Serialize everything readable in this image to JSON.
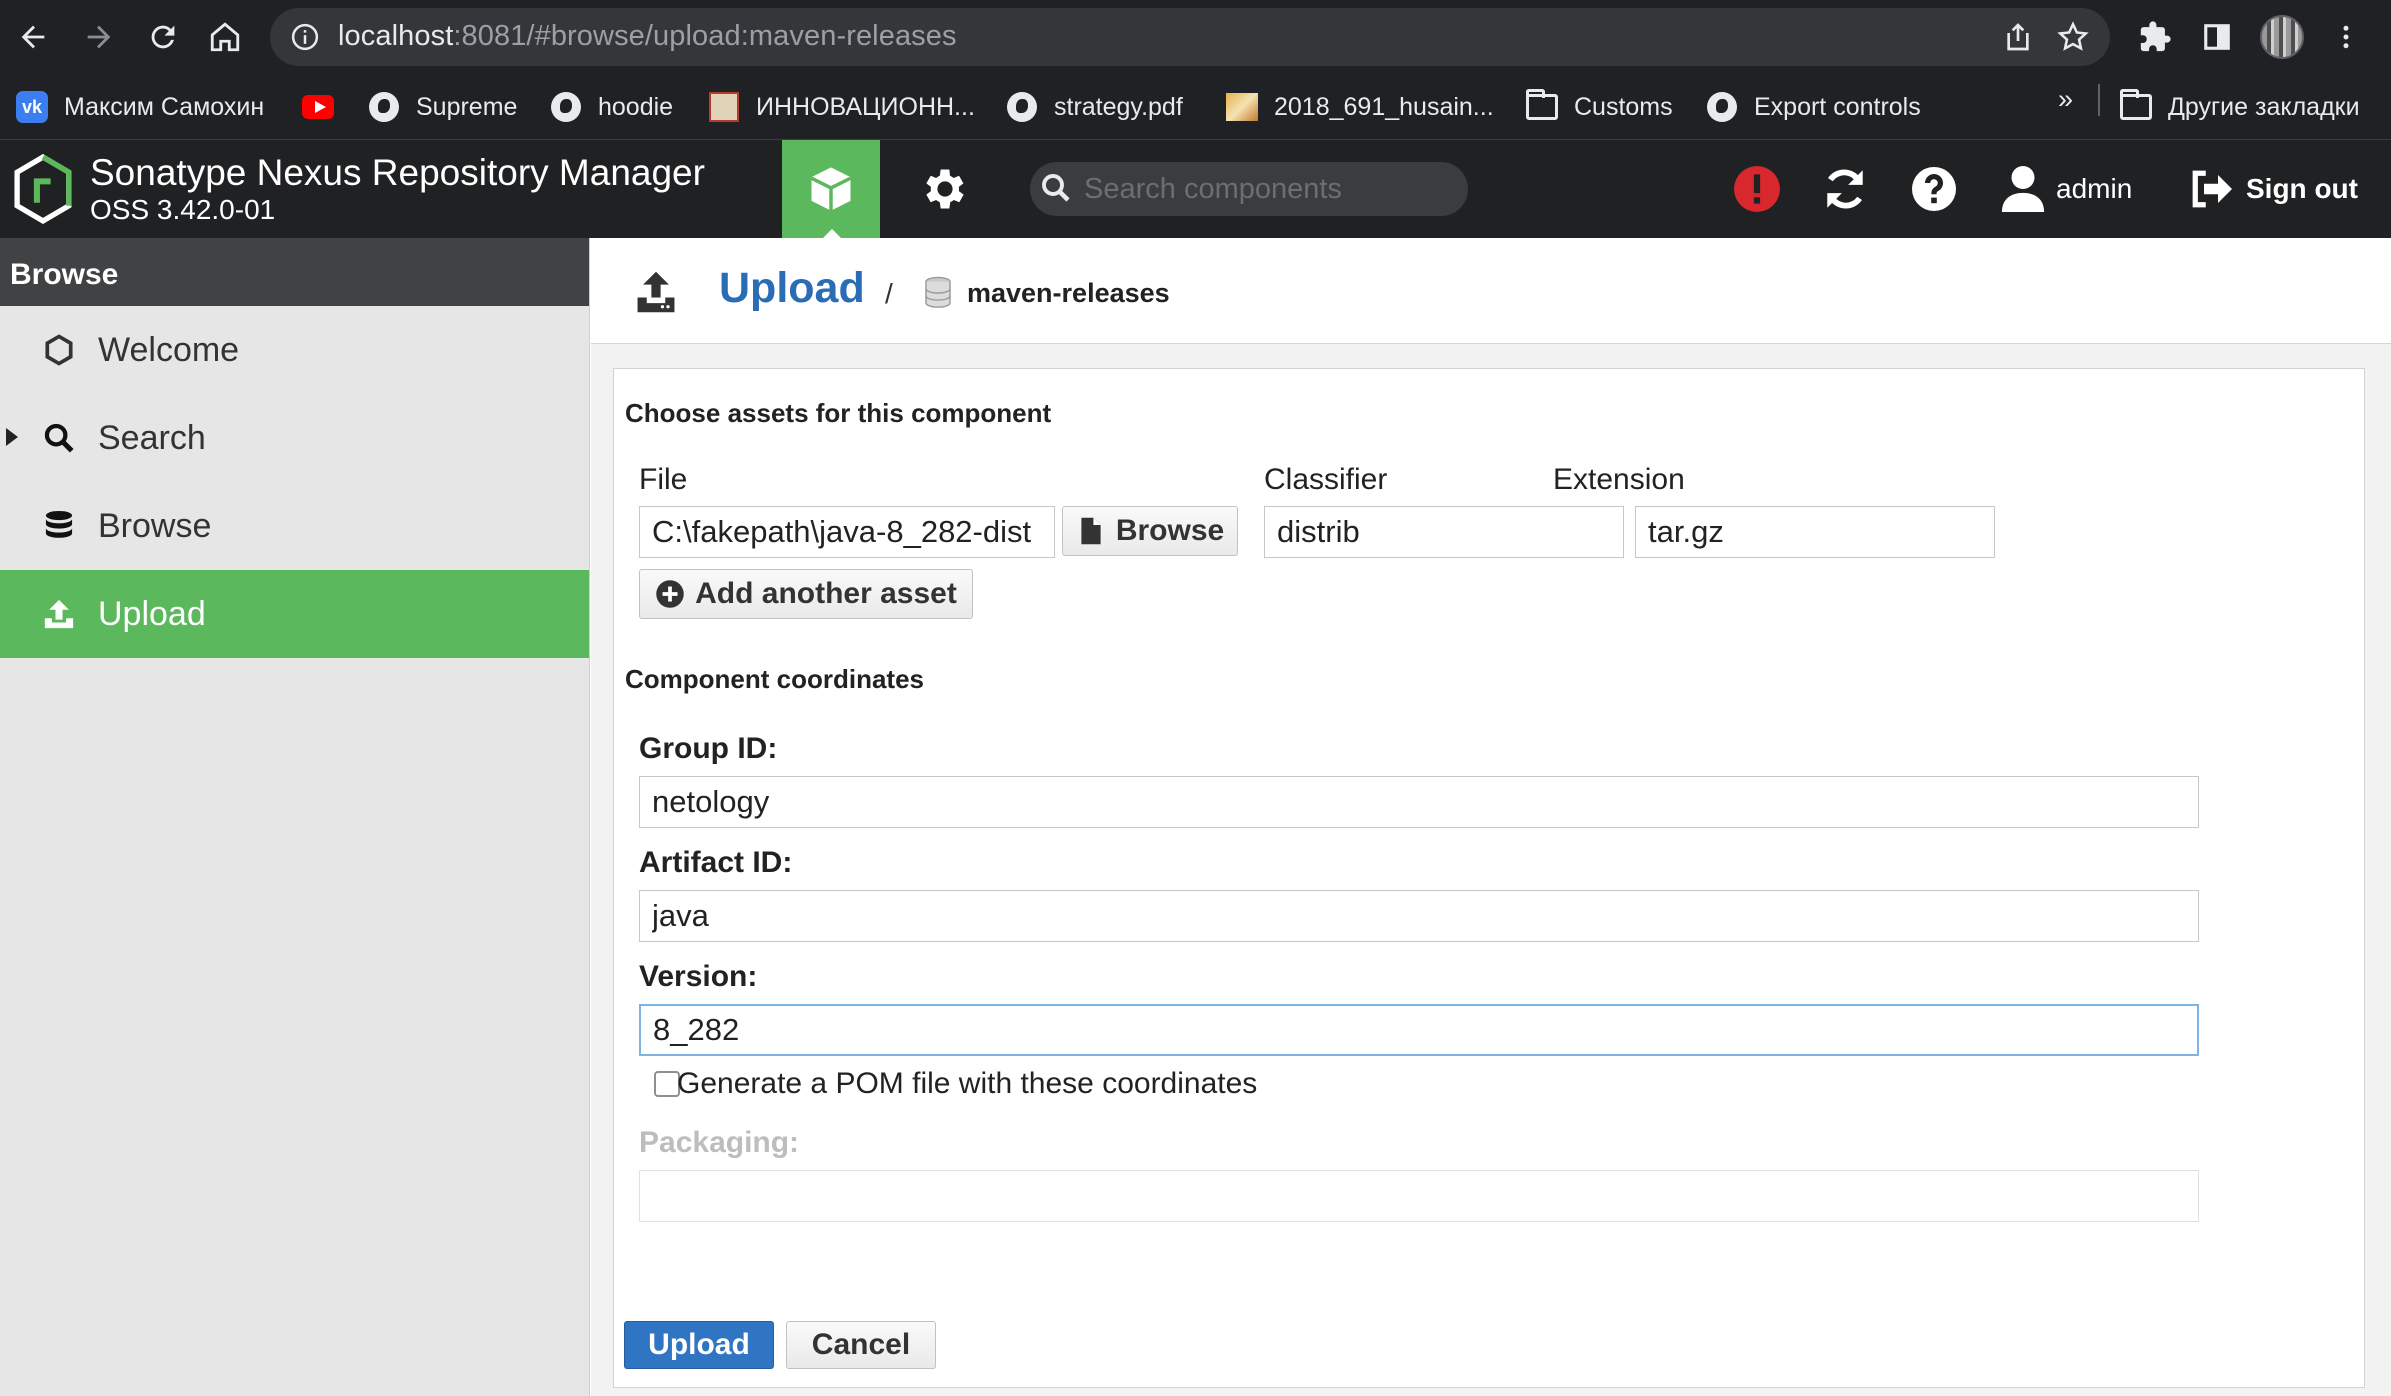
{
  "browser": {
    "url_host": "localhost",
    "url_rest": ":8081/#browse/upload:maven-releases",
    "bookmarks": [
      {
        "label": "Максим Самохин",
        "icon": "vk-icon"
      },
      {
        "label": "",
        "icon": "youtube-icon"
      },
      {
        "label": "Supreme",
        "icon": "globe-icon"
      },
      {
        "label": "hoodie",
        "icon": "globe-icon"
      },
      {
        "label": "ИННОВАЦИОНН...",
        "icon": "image-icon"
      },
      {
        "label": "strategy.pdf",
        "icon": "globe-icon"
      },
      {
        "label": "2018_691_husain...",
        "icon": "image-icon"
      },
      {
        "label": "Customs",
        "icon": "folder-icon"
      },
      {
        "label": "Export controls",
        "icon": "globe-icon"
      }
    ],
    "more_bookmarks": "»",
    "other_bookmarks": "Другие закладки"
  },
  "header": {
    "title": "Sonatype Nexus Repository Manager",
    "version": "OSS 3.42.0-01",
    "search_placeholder": "Search components",
    "user": "admin",
    "sign_out": "Sign out"
  },
  "sidebar": {
    "header": "Browse",
    "items": [
      {
        "label": "Welcome",
        "icon": "hexagon-icon",
        "active": false
      },
      {
        "label": "Search",
        "icon": "search-icon",
        "active": false,
        "expandable": true
      },
      {
        "label": "Browse",
        "icon": "database-icon",
        "active": false
      },
      {
        "label": "Upload",
        "icon": "upload-icon",
        "active": true
      }
    ]
  },
  "breadcrumb": {
    "title": "Upload",
    "separator": "/",
    "repository": "maven-releases"
  },
  "form": {
    "assets_section": "Choose assets for this component",
    "file_label": "File",
    "file_value": "C:\\fakepath\\java-8_282-dist",
    "browse_button": "Browse",
    "classifier_label": "Classifier",
    "classifier_value": "distrib",
    "extension_label": "Extension",
    "extension_value": "tar.gz",
    "add_asset_button": "Add another asset",
    "coordinates_section": "Component coordinates",
    "group_id_label": "Group ID:",
    "group_id_value": "netology",
    "artifact_id_label": "Artifact ID:",
    "artifact_id_value": "java",
    "version_label": "Version:",
    "version_value": "8_282",
    "generate_pom_label": "Generate a POM file with these coordinates",
    "generate_pom_checked": false,
    "packaging_label": "Packaging:",
    "packaging_value": "",
    "upload_button": "Upload",
    "cancel_button": "Cancel"
  },
  "colors": {
    "accent_green": "#5cb85c",
    "link_blue": "#2a6db5",
    "primary_button": "#2f75c3",
    "alert_red": "#d9272e"
  }
}
